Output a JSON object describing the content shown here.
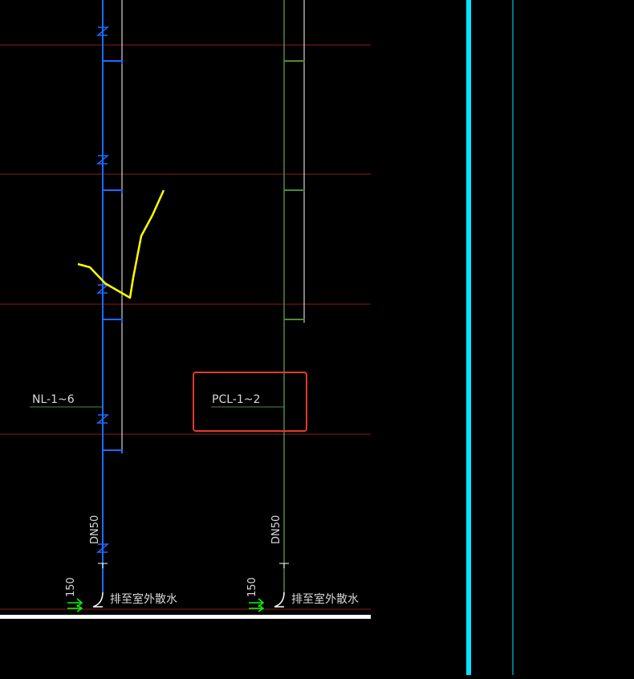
{
  "colors": {
    "background": "#000000",
    "floor_line": "#8b1a1a",
    "blue_pipe": "#1e6bff",
    "green_pipe": "#4f8a3c",
    "white": "#ffffff",
    "cyan": "#00e5ff",
    "yellow_sketch": "#ffff00",
    "red_highlight": "#e23b2e",
    "bright_green": "#00ff00",
    "label_gray": "#d8d8d8"
  },
  "labels": {
    "nl_pipe": "NL-1~6",
    "pcl_pipe": "PCL-1~2",
    "dn_left": "DN50",
    "dn_right": "DN50",
    "dim_left": "150",
    "dim_right": "150",
    "outlet_left": "排至室外散水",
    "outlet_right": "排至室外散水"
  },
  "icons": {
    "pipe_break_symbol": "z-break-icon",
    "floor_arrow": "green-arrow-icon"
  }
}
